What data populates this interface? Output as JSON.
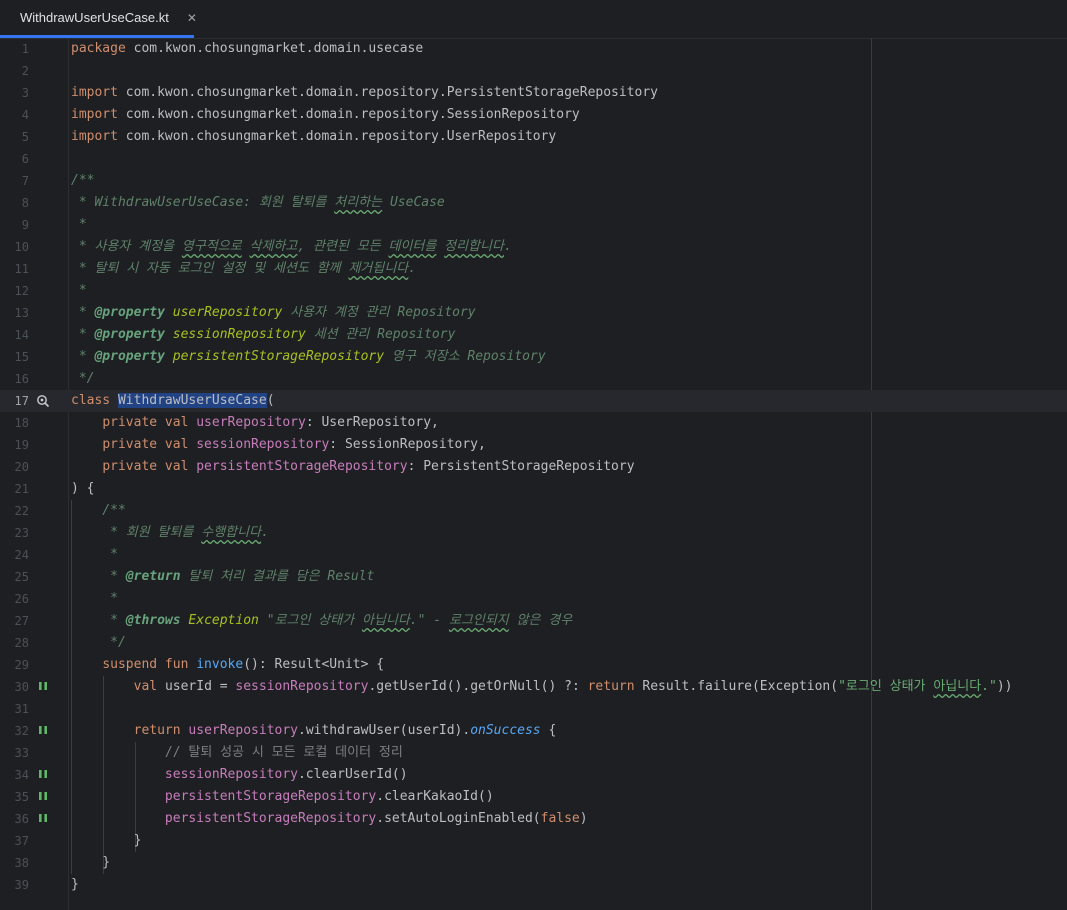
{
  "tab": {
    "file_icon": "kotlin-file-icon",
    "label": "WithdrawUserUseCase.kt",
    "close": "✕"
  },
  "gutter_icons": {
    "17": "implementation-icon",
    "30": "suspend-call-icon",
    "32": "suspend-call-icon",
    "34": "suspend-call-icon",
    "35": "suspend-call-icon",
    "36": "suspend-call-icon"
  },
  "current_line": 17,
  "lines": [
    [
      [
        "kw",
        "package "
      ],
      [
        "pl",
        "com.kwon.chosungmarket.domain.usecase"
      ]
    ],
    [],
    [
      [
        "kw",
        "import "
      ],
      [
        "pl",
        "com.kwon.chosungmarket.domain.repository.PersistentStorageRepository"
      ]
    ],
    [
      [
        "kw",
        "import "
      ],
      [
        "pl",
        "com.kwon.chosungmarket.domain.repository.SessionRepository"
      ]
    ],
    [
      [
        "kw",
        "import "
      ],
      [
        "pl",
        "com.kwon.chosungmarket.domain.repository.UserRepository"
      ]
    ],
    [],
    [
      [
        "dc",
        "/**"
      ]
    ],
    [
      [
        "dc",
        " * WithdrawUserUseCase: 회원 탈퇴를 "
      ],
      [
        "dc wavy",
        "처리하는"
      ],
      [
        "dc",
        " UseCase"
      ]
    ],
    [
      [
        "dc",
        " *"
      ]
    ],
    [
      [
        "dc",
        " * 사용자 계정을 "
      ],
      [
        "dc wavy",
        "영구적으로"
      ],
      [
        "dc",
        " "
      ],
      [
        "dc wavy",
        "삭제하고"
      ],
      [
        "dc",
        ", 관련된 모든 "
      ],
      [
        "dc wavy",
        "데이터를"
      ],
      [
        "dc",
        " "
      ],
      [
        "dc wavy",
        "정리합니다"
      ],
      [
        "dc",
        "."
      ]
    ],
    [
      [
        "dc",
        " * 탈퇴 시 자동 로그인 설정 및 세션도 함께 "
      ],
      [
        "dc wavy",
        "제거됩니다"
      ],
      [
        "dc",
        "."
      ]
    ],
    [
      [
        "dc",
        " *"
      ]
    ],
    [
      [
        "dc",
        " * "
      ],
      [
        "dt",
        "@property"
      ],
      [
        "dc",
        " "
      ],
      [
        "dp",
        "userRepository"
      ],
      [
        "dc",
        " 사용자 계정 관리 Repository"
      ]
    ],
    [
      [
        "dc",
        " * "
      ],
      [
        "dt",
        "@property"
      ],
      [
        "dc",
        " "
      ],
      [
        "dp",
        "sessionRepository"
      ],
      [
        "dc",
        " 세션 관리 Repository"
      ]
    ],
    [
      [
        "dc",
        " * "
      ],
      [
        "dt",
        "@property"
      ],
      [
        "dc",
        " "
      ],
      [
        "dp",
        "persistentStorageRepository"
      ],
      [
        "dc",
        " 영구 저장소 Repository"
      ]
    ],
    [
      [
        "dc",
        " */"
      ]
    ],
    [
      [
        "kw",
        "class "
      ],
      [
        "pl sel",
        "WithdrawUserUseCase"
      ],
      [
        "pl",
        "("
      ]
    ],
    [
      [
        "pl",
        "    "
      ],
      [
        "kw",
        "private val "
      ],
      [
        "pr",
        "userRepository"
      ],
      [
        "pl",
        ": UserRepository,"
      ]
    ],
    [
      [
        "pl",
        "    "
      ],
      [
        "kw",
        "private val "
      ],
      [
        "pr",
        "sessionRepository"
      ],
      [
        "pl",
        ": SessionRepository,"
      ]
    ],
    [
      [
        "pl",
        "    "
      ],
      [
        "kw",
        "private val "
      ],
      [
        "pr",
        "persistentStorageRepository"
      ],
      [
        "pl",
        ": PersistentStorageRepository"
      ]
    ],
    [
      [
        "pl",
        ") {"
      ]
    ],
    [
      [
        "dc",
        "    /**"
      ]
    ],
    [
      [
        "dc",
        "     * 회원 탈퇴를 "
      ],
      [
        "dc wavy",
        "수행합니다"
      ],
      [
        "dc",
        "."
      ]
    ],
    [
      [
        "dc",
        "     *"
      ]
    ],
    [
      [
        "dc",
        "     * "
      ],
      [
        "dt",
        "@return"
      ],
      [
        "dc",
        " 탈퇴 처리 결과를 담은 Result"
      ]
    ],
    [
      [
        "dc",
        "     *"
      ]
    ],
    [
      [
        "dc",
        "     * "
      ],
      [
        "dt",
        "@throws"
      ],
      [
        "dc",
        " "
      ],
      [
        "dp",
        "Exception"
      ],
      [
        "dc",
        " \"로그인 상태가 "
      ],
      [
        "dc wavy",
        "아닙니다"
      ],
      [
        "dc",
        ".\" - "
      ],
      [
        "dc wavy",
        "로그인되지"
      ],
      [
        "dc",
        " 않은 경우"
      ]
    ],
    [
      [
        "dc",
        "     */"
      ]
    ],
    [
      [
        "pl",
        "    "
      ],
      [
        "kw",
        "suspend fun "
      ],
      [
        "fn",
        "invoke"
      ],
      [
        "pl",
        "(): Result<Unit> {"
      ]
    ],
    [
      [
        "pl",
        "        "
      ],
      [
        "kw",
        "val "
      ],
      [
        "pl",
        "userId = "
      ],
      [
        "pr",
        "sessionRepository"
      ],
      [
        "pl",
        ".getUserId().getOrNull() ?: "
      ],
      [
        "kw",
        "return "
      ],
      [
        "pl",
        "Result.failure(Exception("
      ],
      [
        "st",
        "\"로그인 상태가 "
      ],
      [
        "st wavy",
        "아닙니다"
      ],
      [
        "st",
        ".\""
      ],
      [
        "pl",
        "))"
      ]
    ],
    [],
    [
      [
        "pl",
        "        "
      ],
      [
        "kw",
        "return "
      ],
      [
        "pr",
        "userRepository"
      ],
      [
        "pl",
        ".withdrawUser(userId)."
      ],
      [
        "ex",
        "onSuccess"
      ],
      [
        "pl",
        " {"
      ]
    ],
    [
      [
        "pl",
        "            "
      ],
      [
        "cm",
        "// 탈퇴 성공 시 모든 로컬 데이터 정리"
      ]
    ],
    [
      [
        "pl",
        "            "
      ],
      [
        "pr",
        "sessionRepository"
      ],
      [
        "pl",
        ".clearUserId()"
      ]
    ],
    [
      [
        "pl",
        "            "
      ],
      [
        "pr",
        "persistentStorageRepository"
      ],
      [
        "pl",
        ".clearKakaoId()"
      ]
    ],
    [
      [
        "pl",
        "            "
      ],
      [
        "pr",
        "persistentStorageRepository"
      ],
      [
        "pl",
        ".setAutoLoginEnabled("
      ],
      [
        "kw",
        "false"
      ],
      [
        "pl",
        ")"
      ]
    ],
    [
      [
        "pl",
        "        }"
      ]
    ],
    [
      [
        "pl",
        "    }"
      ]
    ],
    [
      [
        "pl",
        "}"
      ]
    ]
  ]
}
